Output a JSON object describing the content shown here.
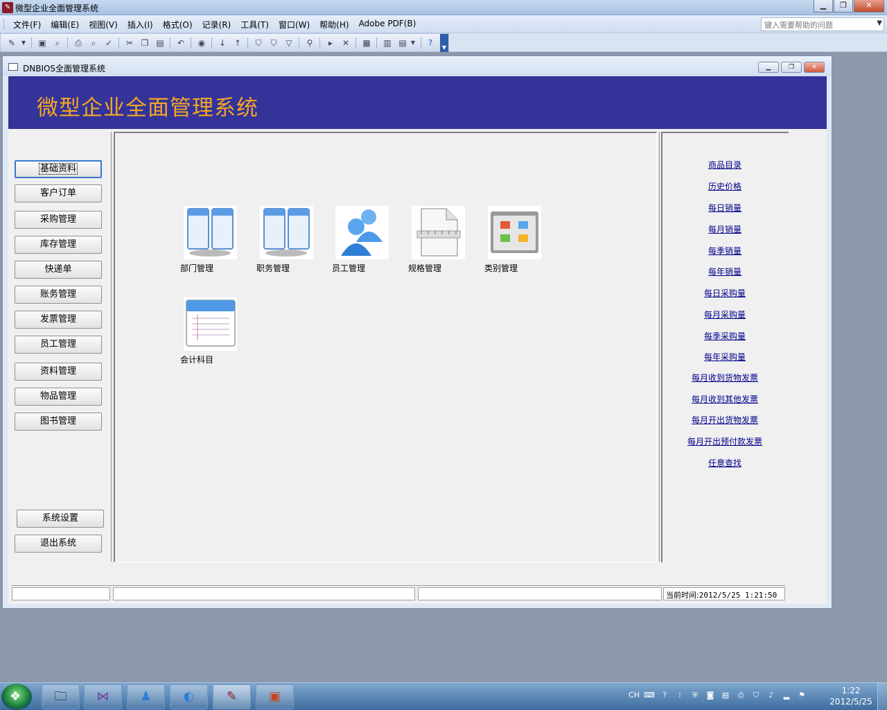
{
  "app": {
    "title": "微型企业全面管理系统",
    "icon": "access-key-icon"
  },
  "menu": [
    "文件(F)",
    "编辑(E)",
    "视图(V)",
    "插入(I)",
    "格式(O)",
    "记录(R)",
    "工具(T)",
    "窗口(W)",
    "帮助(H)",
    "Adobe PDF(B)"
  ],
  "help_search": {
    "placeholder": "键入需要帮助的问题"
  },
  "form": {
    "title": "DNBIOS全面管理系统",
    "header": "微型企业全面管理系统"
  },
  "nav": [
    "基础资料",
    "客户订单",
    "采购管理",
    "库存管理",
    "快递单",
    "账务管理",
    "发票管理",
    "员工管理",
    "资料管理",
    "物品管理",
    "图书管理"
  ],
  "nav_bottom": [
    "系统设置",
    "退出系统"
  ],
  "tiles": [
    "部门管理",
    "职务管理",
    "员工管理",
    "规格管理",
    "类别管理",
    "会计科目"
  ],
  "right_links": [
    "商品目录",
    "历史价格",
    "每日销量",
    "每月销量",
    "每季销量",
    "每年销量",
    "每日采购量",
    "每月采购量",
    "每季采购量",
    "每年采购量",
    "每月收到货物发票",
    "每月收到其他发票",
    "每月开出货物发票",
    "每月开出预付款发票",
    "任意查找"
  ],
  "status": {
    "label": "当前时间:",
    "time": "2012/5/25 1:21:50"
  },
  "taskbar": {
    "lang": "CH",
    "clock_time": "1:22",
    "clock_date": "2012/5/25"
  },
  "colors": {
    "banner": "#33339a",
    "banner_title": "#f5a623",
    "link": "#00008b"
  }
}
